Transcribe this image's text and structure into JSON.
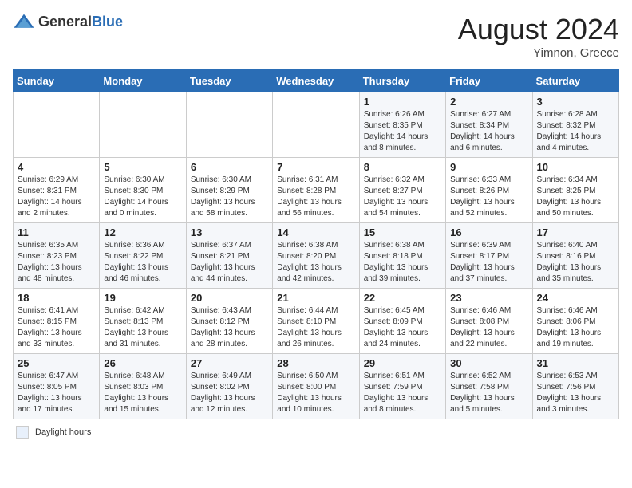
{
  "header": {
    "logo_general": "General",
    "logo_blue": "Blue",
    "title": "August 2024",
    "location": "Yimnon, Greece"
  },
  "days_of_week": [
    "Sunday",
    "Monday",
    "Tuesday",
    "Wednesday",
    "Thursday",
    "Friday",
    "Saturday"
  ],
  "weeks": [
    [
      {
        "day": "",
        "info": ""
      },
      {
        "day": "",
        "info": ""
      },
      {
        "day": "",
        "info": ""
      },
      {
        "day": "",
        "info": ""
      },
      {
        "day": "1",
        "info": "Sunrise: 6:26 AM\nSunset: 8:35 PM\nDaylight: 14 hours and 8 minutes."
      },
      {
        "day": "2",
        "info": "Sunrise: 6:27 AM\nSunset: 8:34 PM\nDaylight: 14 hours and 6 minutes."
      },
      {
        "day": "3",
        "info": "Sunrise: 6:28 AM\nSunset: 8:32 PM\nDaylight: 14 hours and 4 minutes."
      }
    ],
    [
      {
        "day": "4",
        "info": "Sunrise: 6:29 AM\nSunset: 8:31 PM\nDaylight: 14 hours and 2 minutes."
      },
      {
        "day": "5",
        "info": "Sunrise: 6:30 AM\nSunset: 8:30 PM\nDaylight: 14 hours and 0 minutes."
      },
      {
        "day": "6",
        "info": "Sunrise: 6:30 AM\nSunset: 8:29 PM\nDaylight: 13 hours and 58 minutes."
      },
      {
        "day": "7",
        "info": "Sunrise: 6:31 AM\nSunset: 8:28 PM\nDaylight: 13 hours and 56 minutes."
      },
      {
        "day": "8",
        "info": "Sunrise: 6:32 AM\nSunset: 8:27 PM\nDaylight: 13 hours and 54 minutes."
      },
      {
        "day": "9",
        "info": "Sunrise: 6:33 AM\nSunset: 8:26 PM\nDaylight: 13 hours and 52 minutes."
      },
      {
        "day": "10",
        "info": "Sunrise: 6:34 AM\nSunset: 8:25 PM\nDaylight: 13 hours and 50 minutes."
      }
    ],
    [
      {
        "day": "11",
        "info": "Sunrise: 6:35 AM\nSunset: 8:23 PM\nDaylight: 13 hours and 48 minutes."
      },
      {
        "day": "12",
        "info": "Sunrise: 6:36 AM\nSunset: 8:22 PM\nDaylight: 13 hours and 46 minutes."
      },
      {
        "day": "13",
        "info": "Sunrise: 6:37 AM\nSunset: 8:21 PM\nDaylight: 13 hours and 44 minutes."
      },
      {
        "day": "14",
        "info": "Sunrise: 6:38 AM\nSunset: 8:20 PM\nDaylight: 13 hours and 42 minutes."
      },
      {
        "day": "15",
        "info": "Sunrise: 6:38 AM\nSunset: 8:18 PM\nDaylight: 13 hours and 39 minutes."
      },
      {
        "day": "16",
        "info": "Sunrise: 6:39 AM\nSunset: 8:17 PM\nDaylight: 13 hours and 37 minutes."
      },
      {
        "day": "17",
        "info": "Sunrise: 6:40 AM\nSunset: 8:16 PM\nDaylight: 13 hours and 35 minutes."
      }
    ],
    [
      {
        "day": "18",
        "info": "Sunrise: 6:41 AM\nSunset: 8:15 PM\nDaylight: 13 hours and 33 minutes."
      },
      {
        "day": "19",
        "info": "Sunrise: 6:42 AM\nSunset: 8:13 PM\nDaylight: 13 hours and 31 minutes."
      },
      {
        "day": "20",
        "info": "Sunrise: 6:43 AM\nSunset: 8:12 PM\nDaylight: 13 hours and 28 minutes."
      },
      {
        "day": "21",
        "info": "Sunrise: 6:44 AM\nSunset: 8:10 PM\nDaylight: 13 hours and 26 minutes."
      },
      {
        "day": "22",
        "info": "Sunrise: 6:45 AM\nSunset: 8:09 PM\nDaylight: 13 hours and 24 minutes."
      },
      {
        "day": "23",
        "info": "Sunrise: 6:46 AM\nSunset: 8:08 PM\nDaylight: 13 hours and 22 minutes."
      },
      {
        "day": "24",
        "info": "Sunrise: 6:46 AM\nSunset: 8:06 PM\nDaylight: 13 hours and 19 minutes."
      }
    ],
    [
      {
        "day": "25",
        "info": "Sunrise: 6:47 AM\nSunset: 8:05 PM\nDaylight: 13 hours and 17 minutes."
      },
      {
        "day": "26",
        "info": "Sunrise: 6:48 AM\nSunset: 8:03 PM\nDaylight: 13 hours and 15 minutes."
      },
      {
        "day": "27",
        "info": "Sunrise: 6:49 AM\nSunset: 8:02 PM\nDaylight: 13 hours and 12 minutes."
      },
      {
        "day": "28",
        "info": "Sunrise: 6:50 AM\nSunset: 8:00 PM\nDaylight: 13 hours and 10 minutes."
      },
      {
        "day": "29",
        "info": "Sunrise: 6:51 AM\nSunset: 7:59 PM\nDaylight: 13 hours and 8 minutes."
      },
      {
        "day": "30",
        "info": "Sunrise: 6:52 AM\nSunset: 7:58 PM\nDaylight: 13 hours and 5 minutes."
      },
      {
        "day": "31",
        "info": "Sunrise: 6:53 AM\nSunset: 7:56 PM\nDaylight: 13 hours and 3 minutes."
      }
    ]
  ],
  "legend": {
    "daylight_label": "Daylight hours"
  },
  "colors": {
    "header_bg": "#2a6db5",
    "accent": "#2a6db5"
  }
}
